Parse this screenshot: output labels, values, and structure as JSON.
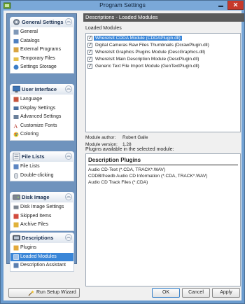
{
  "window": {
    "title": "Program Settings"
  },
  "sidebar": {
    "groups": [
      {
        "title": "General Settings",
        "items": [
          "General",
          "Catalogs",
          "External Programs",
          "Temporary Files",
          "Settings Storage"
        ]
      },
      {
        "title": "User Interface",
        "items": [
          "Language",
          "Display Settings",
          "Advanced Settings",
          "Customize Fonts",
          "Coloring"
        ]
      },
      {
        "title": "File Lists",
        "items": [
          "File Lists",
          "Double-clicking"
        ]
      },
      {
        "title": "Disk Image",
        "items": [
          "Disk Image Settings",
          "Skipped Items",
          "Archive Files"
        ]
      },
      {
        "title": "Descriptions",
        "items": [
          "Plugins",
          "Loaded Modules",
          "Description Assistant"
        ]
      }
    ],
    "selected_item": "Loaded Modules"
  },
  "panel": {
    "header": "Descriptions - Loaded Modules",
    "modules_label": "Loaded Modules",
    "modules": [
      {
        "label": "WhereIsIt CDDA Module (CDDAPlugin.dll)",
        "checked": true,
        "selected": true
      },
      {
        "label": "Digital Cameras Raw Files Thumbnails (DcrawPlugin.dll)",
        "checked": true,
        "selected": false
      },
      {
        "label": "WhereIsIt Graphics Plugins Module (DescGraphics.dll)",
        "checked": true,
        "selected": false
      },
      {
        "label": "WhereIsIt Main Description Module (DescPlugin.dll)",
        "checked": true,
        "selected": false
      },
      {
        "label": "Generic Text File Import Module (GenTextPlugin.dll)",
        "checked": true,
        "selected": false
      }
    ],
    "author_label": "Module author:",
    "author_value": "Robert Galle",
    "version_label": "Module version:",
    "version_value": "1.28",
    "plugins_label": "Plugins available in the selected module:",
    "plugins_header": "Description Plugins",
    "plugins": [
      "Audio CD-Text (*.CDA, TRACK*.WAV)",
      "CDDB/freedb Audio CD Information (*.CDA, TRACK*.WAV)",
      "Audio CD Track Files (*.CDA)"
    ]
  },
  "buttons": {
    "wizard": "Run Setup Wizard",
    "ok": "OK",
    "cancel": "Cancel",
    "apply": "Apply"
  },
  "icons": {
    "app": "app-icon",
    "general_settings": "gear-icon",
    "user_interface": "monitor-icon",
    "file_lists": "file-list-icon",
    "disk_image": "disk-icon",
    "descriptions": "description-icon"
  },
  "colors": {
    "selection": "#3a86d8",
    "sidebar": "#6f93bd",
    "panel_header": "#5a5a5a",
    "close": "#c7392b"
  }
}
